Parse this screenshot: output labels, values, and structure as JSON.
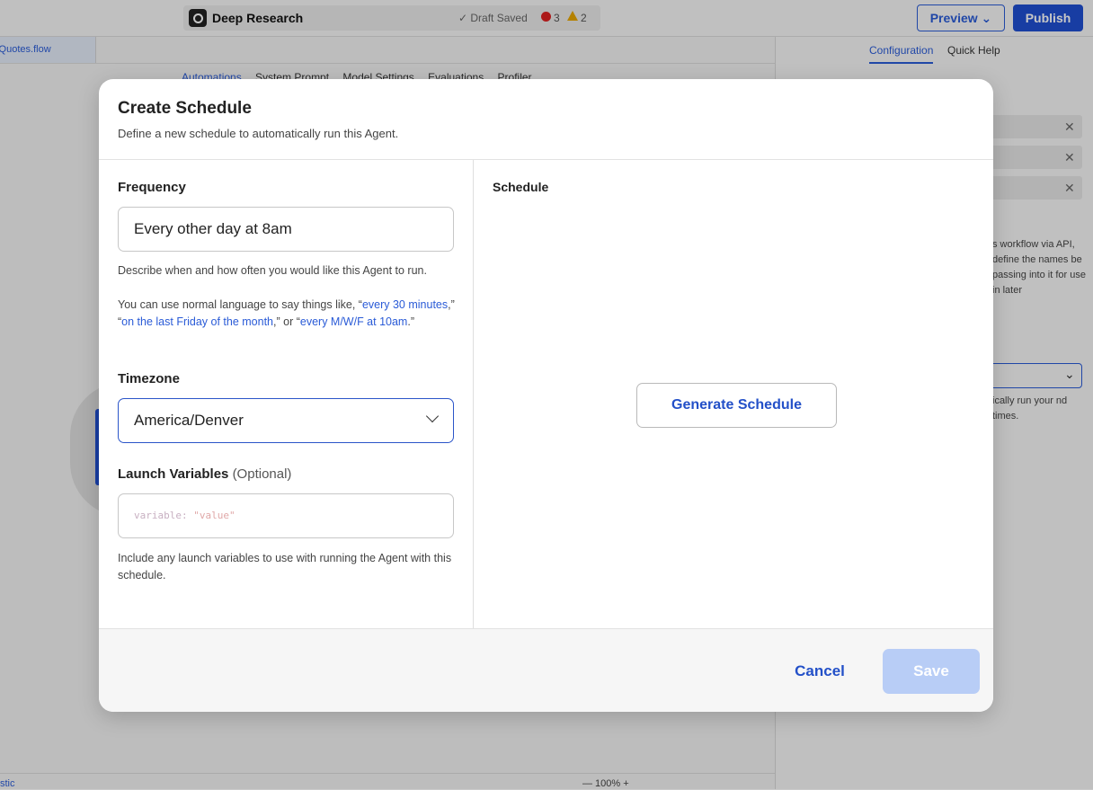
{
  "app": {
    "title": "Deep Research",
    "draft_status": "✓ Draft Saved",
    "error_count": "3",
    "warning_count": "2",
    "preview_label": "Preview ⌄",
    "publish_label": "Publish",
    "file_tab": "ctQuotes.flow",
    "sub_tabs": [
      "Automations",
      "System Prompt",
      "Model Settings",
      "Evaluations",
      "Profiler"
    ],
    "right_tabs": [
      "Configuration",
      "Quick Help"
    ],
    "right_text_1": "s workflow via API, define the names be passing into it for use in later",
    "right_text_2": "ically run your nd times.",
    "bottom_left": "stic",
    "bottom_zoom": "— 100% +"
  },
  "modal": {
    "title": "Create Schedule",
    "subtitle": "Define a new schedule to automatically run this Agent.",
    "frequency": {
      "label": "Frequency",
      "value": "Every other day at 8am",
      "help": "Describe when and how often you would like this Agent to run.",
      "examples_prefix": "You can use normal language to say things like, “",
      "example_1": "every 30 minutes",
      "sep_1": ",” “",
      "example_2": "on the last Friday of the month",
      "sep_2": ",” or “",
      "example_3": "every M/W/F at 10am",
      "examples_suffix": ".”"
    },
    "timezone": {
      "label": "Timezone",
      "value": "America/Denver"
    },
    "launch_variables": {
      "label": "Launch Variables",
      "optional": "(Optional)",
      "placeholder_key": "variable: ",
      "placeholder_value": "\"value\"",
      "help": "Include any launch variables to use with running the Agent with this schedule."
    },
    "schedule": {
      "label": "Schedule",
      "generate_label": "Generate Schedule"
    },
    "footer": {
      "cancel_label": "Cancel",
      "save_label": "Save"
    }
  },
  "colors": {
    "accent": "#2350c8",
    "save_disabled": "#b8cdf6",
    "error": "#dd2222",
    "warning": "#e7a600"
  }
}
